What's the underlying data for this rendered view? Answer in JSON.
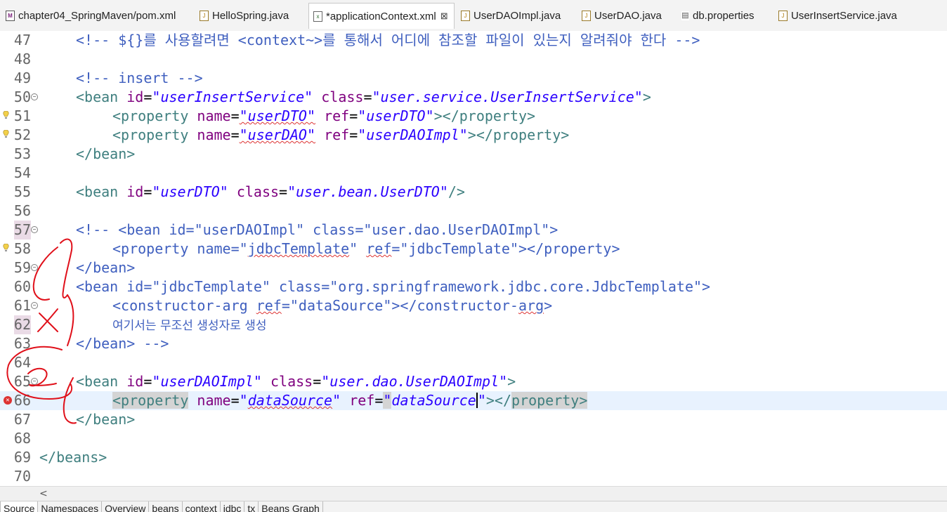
{
  "tabs": [
    {
      "label": "chapter04_SpringMaven/pom.xml",
      "icon": "maven-file-icon",
      "active": false
    },
    {
      "label": "HelloSpring.java",
      "icon": "java-file-icon",
      "active": false
    },
    {
      "label": "*applicationContext.xml",
      "icon": "xml-file-icon",
      "active": true,
      "close": "⊠"
    },
    {
      "label": "UserDAOImpl.java",
      "icon": "java-file-icon",
      "active": false
    },
    {
      "label": "UserDAO.java",
      "icon": "java-file-icon",
      "active": false
    },
    {
      "label": "db.properties",
      "icon": "properties-file-icon",
      "active": false
    },
    {
      "label": "UserInsertService.java",
      "icon": "java-file-icon",
      "active": false
    }
  ],
  "lines": {
    "n47": "47",
    "n48": "48",
    "n49": "49",
    "n50": "50",
    "n51": "51",
    "n52": "52",
    "n53": "53",
    "n54": "54",
    "n55": "55",
    "n56": "56",
    "n57": "57",
    "n58": "58",
    "n59": "59",
    "n60": "60",
    "n61": "61",
    "n62": "62",
    "n63": "63",
    "n64": "64",
    "n65": "65",
    "n66": "66",
    "n67": "67",
    "n68": "68",
    "n69": "69",
    "n70": "70"
  },
  "code": {
    "l47": "<!-- ${}를 사용할려면 <context~>를 통해서 어디에 참조할 파일이 있는지 알려줘야 한다 -->",
    "l49": "<!-- insert -->",
    "l50_open": "<bean",
    "l50_a1": "id",
    "l50_v1": "\"userInsertService\"",
    "l50_a2": "class",
    "l50_v2": "\"user.service.UserInsertService\"",
    "l50_close": ">",
    "l51_open": "<property",
    "l51_a1": "name",
    "l51_v1": "\"userDTO\"",
    "l51_a2": "ref",
    "l51_v2": "\"userDTO\"",
    "l51_close": "></property>",
    "l52_open": "<property",
    "l52_a1": "name",
    "l52_v1": "\"userDAO\"",
    "l52_a2": "ref",
    "l52_v2": "\"userDAOImpl\"",
    "l52_close": "></property>",
    "l53": "</bean>",
    "l55_open": "<bean",
    "l55_a1": "id",
    "l55_v1": "\"userDTO\"",
    "l55_a2": "class",
    "l55_v2": "\"user.bean.UserDTO\"",
    "l55_close": "/>",
    "l57": "<!-- <bean id=\"userDAOImpl\" class=\"user.dao.UserDAOImpl\">",
    "l58a": "<property name=\"",
    "l58b": "jdbcTemplate",
    "l58c": "\" ",
    "l58d": "ref",
    "l58e": "=\"jdbcTemplate\"></property>",
    "l59": "</bean>",
    "l60": "<bean id=\"jdbcTemplate\" class=\"org.springframework.jdbc.core.JdbcTemplate\">",
    "l61a": "<constructor-arg ",
    "l61b": "ref",
    "l61c": "=\"dataSource\"></constructor-",
    "l61d": "arg",
    "l61e": ">",
    "l62": "여기서는 무조선 생성자로 생성",
    "l63": "</bean> -->",
    "l65_open": "<bean",
    "l65_a1": "id",
    "l65_v1": "\"userDAOImpl\"",
    "l65_a2": "class",
    "l65_v2": "\"user.dao.UserDAOImpl\"",
    "l65_close": ">",
    "l66_open": "<",
    "l66_tag": "property",
    "l66_a1": "name",
    "l66_v1q": "\"",
    "l66_v1": "dataSource",
    "l66_v1e": "\"",
    "l66_a2": "ref",
    "l66_eq": "=",
    "l66_v2q": "\"",
    "l66_v2": "dataSource",
    "l66_v2e": "\"",
    "l66_close1": "></",
    "l66_close2": "property",
    "l66_close3": ">",
    "l67": "</bean>",
    "l69": "</beans>"
  },
  "scroll_arrow": "<",
  "bottom_tabs": [
    "Source",
    "Namespaces",
    "Overview",
    "beans",
    "context",
    "jdbc",
    "tx",
    "Beans Graph"
  ],
  "colors": {
    "comment": "#3f5fbf",
    "tag": "#3f7f7f",
    "attribute": "#7f007f",
    "value": "#2a00ff",
    "current_line": "#e8f2fe",
    "annotation_ink": "#e0101a"
  }
}
